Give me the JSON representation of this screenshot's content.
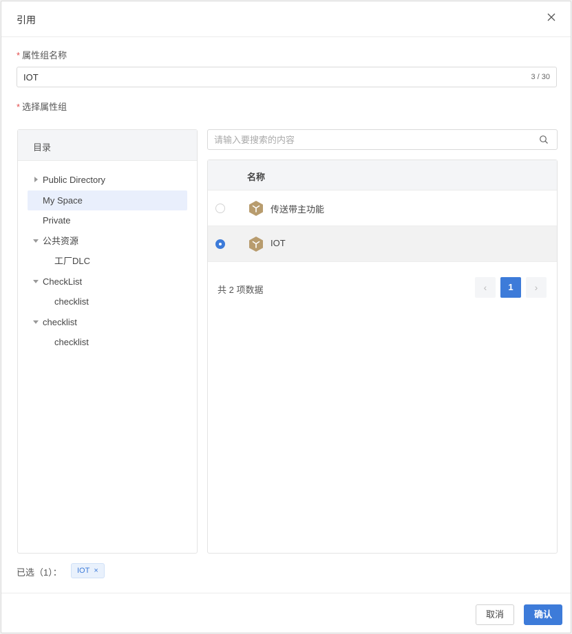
{
  "dialog": {
    "title": "引用",
    "close_icon": "close-icon"
  },
  "form": {
    "name_label": "属性组名称",
    "name_required": "*",
    "name_value": "IOT",
    "name_count": "3 / 30",
    "group_label": "选择属性组",
    "group_required": "*"
  },
  "tree": {
    "header": "目录",
    "nodes": [
      {
        "label": "Public Directory",
        "caret": "right",
        "selected": false
      },
      {
        "label": "My Space",
        "caret": "none",
        "selected": true
      },
      {
        "label": "Private",
        "caret": "none",
        "selected": false
      },
      {
        "label": "公共资源",
        "caret": "down",
        "selected": false
      },
      {
        "label": "工厂DLC",
        "caret": "none",
        "selected": false
      },
      {
        "label": "CheckList",
        "caret": "down",
        "selected": false
      },
      {
        "label": "checklist",
        "caret": "none",
        "selected": false
      },
      {
        "label": "checklist",
        "caret": "down",
        "selected": false
      },
      {
        "label": "checklist",
        "caret": "none",
        "selected": false
      }
    ]
  },
  "search": {
    "placeholder": "请输入要搜索的内容",
    "icon": "search-icon"
  },
  "table": {
    "column_name": "名称",
    "rows": [
      {
        "name": "传送带主功能",
        "checked": false,
        "icon": "cube-icon"
      },
      {
        "name": "IOT",
        "checked": true,
        "icon": "cube-icon"
      }
    ],
    "total": "共 2 项数据",
    "pagination": {
      "prev": "‹",
      "current": "1",
      "next": "›"
    }
  },
  "selection": {
    "label": "已选（1）：",
    "tags": [
      {
        "label": "IOT",
        "remove": "×"
      }
    ]
  },
  "footer": {
    "cancel": "取消",
    "confirm": "确认"
  },
  "colors": {
    "primary": "#3d7bd9",
    "required": "#e34d4d",
    "cube": "#b89c6e"
  }
}
